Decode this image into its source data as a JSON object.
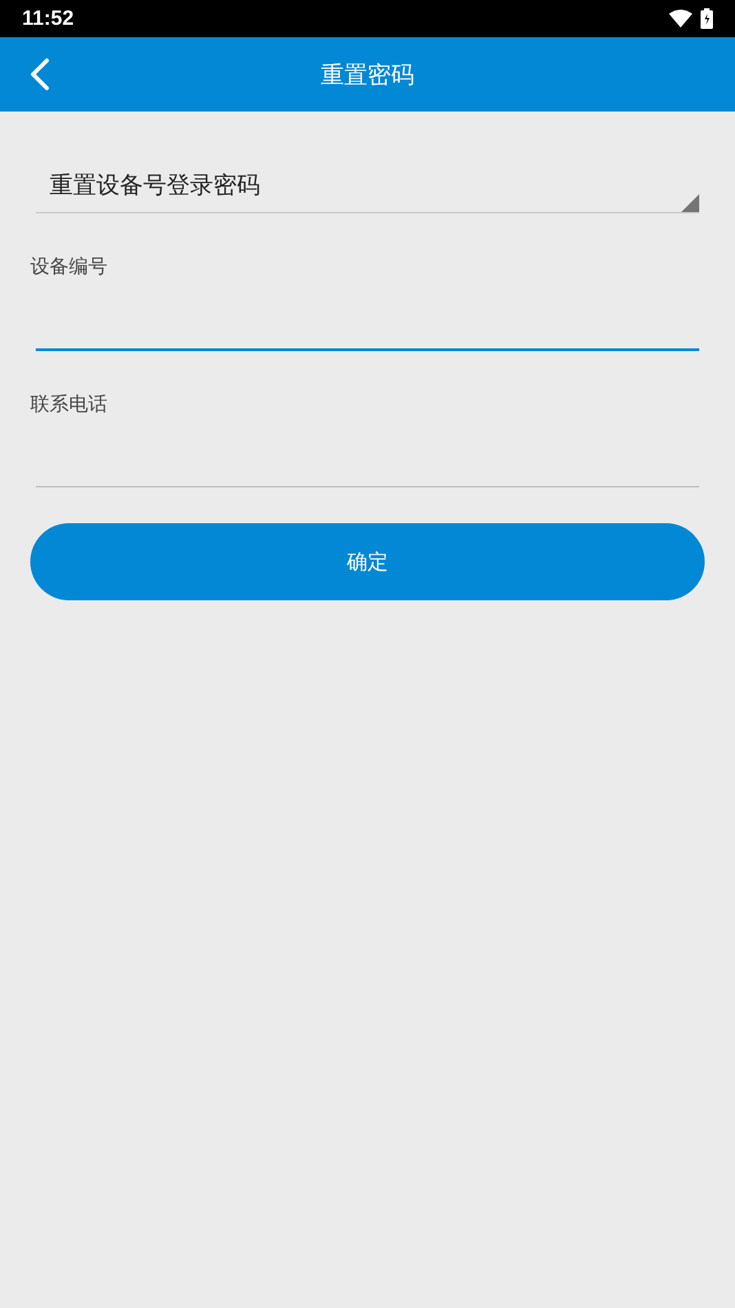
{
  "status_bar": {
    "time": "11:52"
  },
  "app_bar": {
    "title": "重置密码"
  },
  "spinner": {
    "value": "重置设备号登录密码"
  },
  "fields": [
    {
      "label": "设备编号",
      "focused": true
    },
    {
      "label": "联系电话",
      "focused": false
    }
  ],
  "submit_button": "确定"
}
